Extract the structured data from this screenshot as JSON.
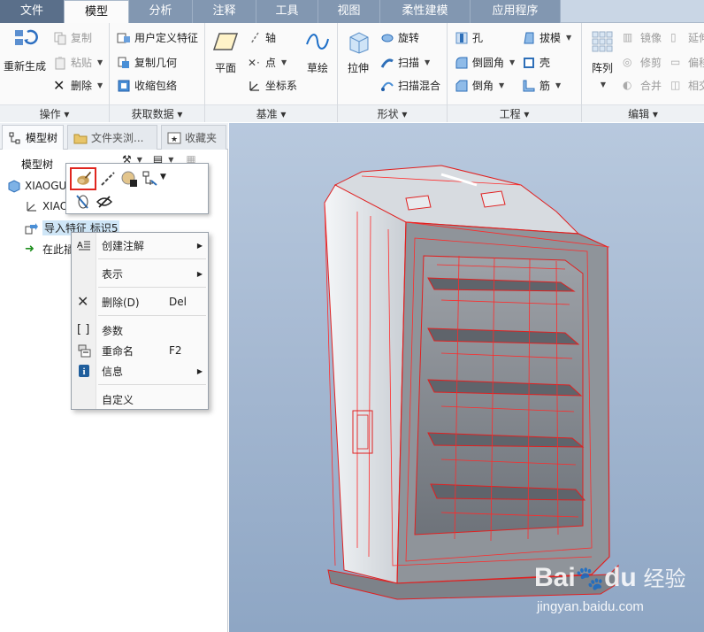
{
  "tabs": [
    {
      "label": "文件",
      "kind": "file"
    },
    {
      "label": "模型",
      "kind": "active"
    },
    {
      "label": "分析",
      "kind": "dark"
    },
    {
      "label": "注释",
      "kind": "dark"
    },
    {
      "label": "工具",
      "kind": "dark"
    },
    {
      "label": "视图",
      "kind": "dark"
    },
    {
      "label": "柔性建模",
      "kind": "dark"
    },
    {
      "label": "应用程序",
      "kind": "dark"
    }
  ],
  "ribbon": {
    "operations": {
      "label": "操作",
      "regen": "重新生成",
      "copy": "复制",
      "paste": "粘贴",
      "delete": "删除"
    },
    "getdata": {
      "label": "获取数据",
      "udf": "用户定义特征",
      "copygeom": "复制几何",
      "shrinkwrap": "收缩包络"
    },
    "datum": {
      "label": "基准",
      "plane": "平面",
      "axis": "轴",
      "point": "点",
      "csys": "坐标系",
      "sketch": "草绘"
    },
    "shapes": {
      "label": "形状",
      "extrude": "拉伸",
      "revolve": "旋转",
      "sweep": "扫描",
      "blend": "扫描混合"
    },
    "engineering": {
      "label": "工程",
      "hole": "孔",
      "round": "倒圆角",
      "chamfer": "倒角",
      "draft": "拔模",
      "shell": "壳",
      "rib": "筋"
    },
    "editing": {
      "label": "编辑",
      "pattern": "阵列",
      "mirror": "镜像",
      "trim": "修剪",
      "merge": "合并",
      "extend": "延伸",
      "offset": "偏移",
      "intersect": "相交"
    }
  },
  "panel_tabs": [
    "模型树",
    "文件夹浏...",
    "收藏夹"
  ],
  "tree": {
    "header": "模型树",
    "root": "XIAOGU",
    "csys": "XIAO",
    "import_feature": "导入特征 标识5",
    "insert_here": "在此插"
  },
  "context_menu": {
    "create_note": "创建注解",
    "represent": "表示",
    "delete": "删除(D)",
    "delete_key": "Del",
    "params": "参数",
    "rename": "重命名",
    "rename_key": "F2",
    "info": "信息",
    "customize": "自定义"
  },
  "watermark": {
    "brand_a": "Bai",
    "brand_b": "du",
    "product": "经验",
    "url": "jingyan.baidu.com"
  },
  "colors": {
    "accent": "#e0261f",
    "tab_dark": "#8297b1",
    "file_tab": "#5a6f8a",
    "viewport_top": "#b8c9de",
    "viewport_bottom": "#8ea6c4"
  }
}
